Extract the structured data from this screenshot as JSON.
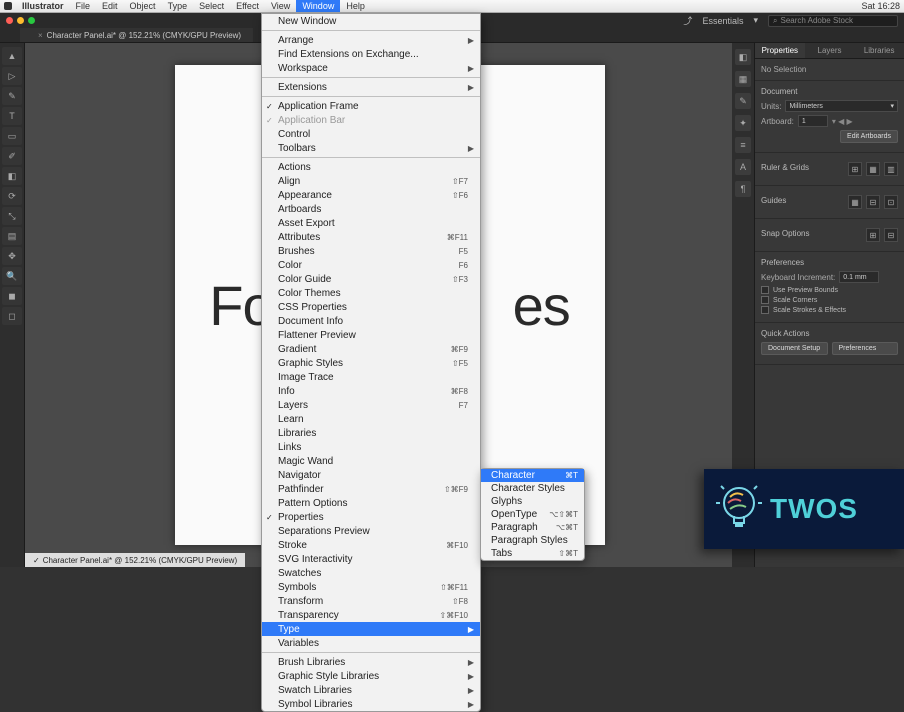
{
  "mac_menu": {
    "app": "Illustrator",
    "items": [
      "File",
      "Edit",
      "Object",
      "Type",
      "Select",
      "Effect",
      "View",
      "Window",
      "Help"
    ],
    "active_index": 7,
    "right": {
      "time": "Sat 16:28"
    }
  },
  "window": {
    "essentials": "Essentials",
    "search_placeholder": "Search Adobe Stock"
  },
  "doc_tab": {
    "label": "Character Panel.ai* @ 152.21% (CMYK/GPU Preview)",
    "close": "×"
  },
  "canvas": {
    "text_left": "Fo",
    "text_right": "es"
  },
  "footer_file": "Character Panel.ai* @ 152.21% (CMYK/GPU Preview)",
  "window_menu": {
    "groups": [
      [
        {
          "label": "New Window"
        }
      ],
      [
        {
          "label": "Arrange",
          "arrow": true
        },
        {
          "label": "Find Extensions on Exchange..."
        },
        {
          "label": "Workspace",
          "arrow": true
        }
      ],
      [
        {
          "label": "Extensions",
          "arrow": true
        }
      ],
      [
        {
          "label": "Application Frame",
          "checked": true
        },
        {
          "label": "Application Bar",
          "checked": true,
          "disabled": true
        },
        {
          "label": "Control"
        },
        {
          "label": "Toolbars",
          "arrow": true
        }
      ],
      [
        {
          "label": "Actions"
        },
        {
          "label": "Align",
          "sc": "⇧F7"
        },
        {
          "label": "Appearance",
          "sc": "⇧F6"
        },
        {
          "label": "Artboards"
        },
        {
          "label": "Asset Export"
        },
        {
          "label": "Attributes",
          "sc": "⌘F11"
        },
        {
          "label": "Brushes",
          "sc": "F5"
        },
        {
          "label": "Color",
          "sc": "F6"
        },
        {
          "label": "Color Guide",
          "sc": "⇧F3"
        },
        {
          "label": "Color Themes"
        },
        {
          "label": "CSS Properties"
        },
        {
          "label": "Document Info"
        },
        {
          "label": "Flattener Preview"
        },
        {
          "label": "Gradient",
          "sc": "⌘F9"
        },
        {
          "label": "Graphic Styles",
          "sc": "⇧F5"
        },
        {
          "label": "Image Trace"
        },
        {
          "label": "Info",
          "sc": "⌘F8"
        },
        {
          "label": "Layers",
          "sc": "F7"
        },
        {
          "label": "Learn"
        },
        {
          "label": "Libraries"
        },
        {
          "label": "Links"
        },
        {
          "label": "Magic Wand"
        },
        {
          "label": "Navigator"
        },
        {
          "label": "Pathfinder",
          "sc": "⇧⌘F9"
        },
        {
          "label": "Pattern Options"
        },
        {
          "label": "Properties",
          "checked": true
        },
        {
          "label": "Separations Preview"
        },
        {
          "label": "Stroke",
          "sc": "⌘F10"
        },
        {
          "label": "SVG Interactivity"
        },
        {
          "label": "Swatches"
        },
        {
          "label": "Symbols",
          "sc": "⇧⌘F11"
        },
        {
          "label": "Transform",
          "sc": "⇧F8"
        },
        {
          "label": "Transparency",
          "sc": "⇧⌘F10"
        },
        {
          "label": "Type",
          "arrow": true,
          "hl": true
        },
        {
          "label": "Variables"
        }
      ],
      [
        {
          "label": "Brush Libraries",
          "arrow": true
        },
        {
          "label": "Graphic Style Libraries",
          "arrow": true
        },
        {
          "label": "Swatch Libraries",
          "arrow": true
        },
        {
          "label": "Symbol Libraries",
          "arrow": true
        }
      ]
    ]
  },
  "type_submenu": [
    {
      "label": "Character",
      "sc": "⌘T",
      "hl": true
    },
    {
      "label": "Character Styles"
    },
    {
      "label": "Glyphs"
    },
    {
      "label": "OpenType",
      "sc": "⌥⇧⌘T"
    },
    {
      "label": "Paragraph",
      "sc": "⌥⌘T"
    },
    {
      "label": "Paragraph Styles"
    },
    {
      "label": "Tabs",
      "sc": "⇧⌘T"
    }
  ],
  "props": {
    "tabs": [
      "Properties",
      "Layers",
      "Libraries"
    ],
    "no_selection": "No Selection",
    "document": {
      "title": "Document",
      "units_label": "Units:",
      "units_value": "Millimeters",
      "artboard_label": "Artboard:",
      "artboard_value": "1",
      "edit_btn": "Edit Artboards"
    },
    "ruler_grids": {
      "title": "Ruler & Grids"
    },
    "guides": {
      "title": "Guides"
    },
    "snap_options": {
      "title": "Snap Options"
    },
    "preferences": {
      "title": "Preferences",
      "kb_inc_label": "Keyboard Increment:",
      "kb_inc_value": "0.1 mm",
      "chk1": "Use Preview Bounds",
      "chk2": "Scale Corners",
      "chk3": "Scale Strokes & Effects"
    },
    "quick_actions": {
      "title": "Quick Actions",
      "btn1": "Document Setup",
      "btn2": "Preferences"
    }
  },
  "watermark": {
    "text": "TWOS"
  }
}
